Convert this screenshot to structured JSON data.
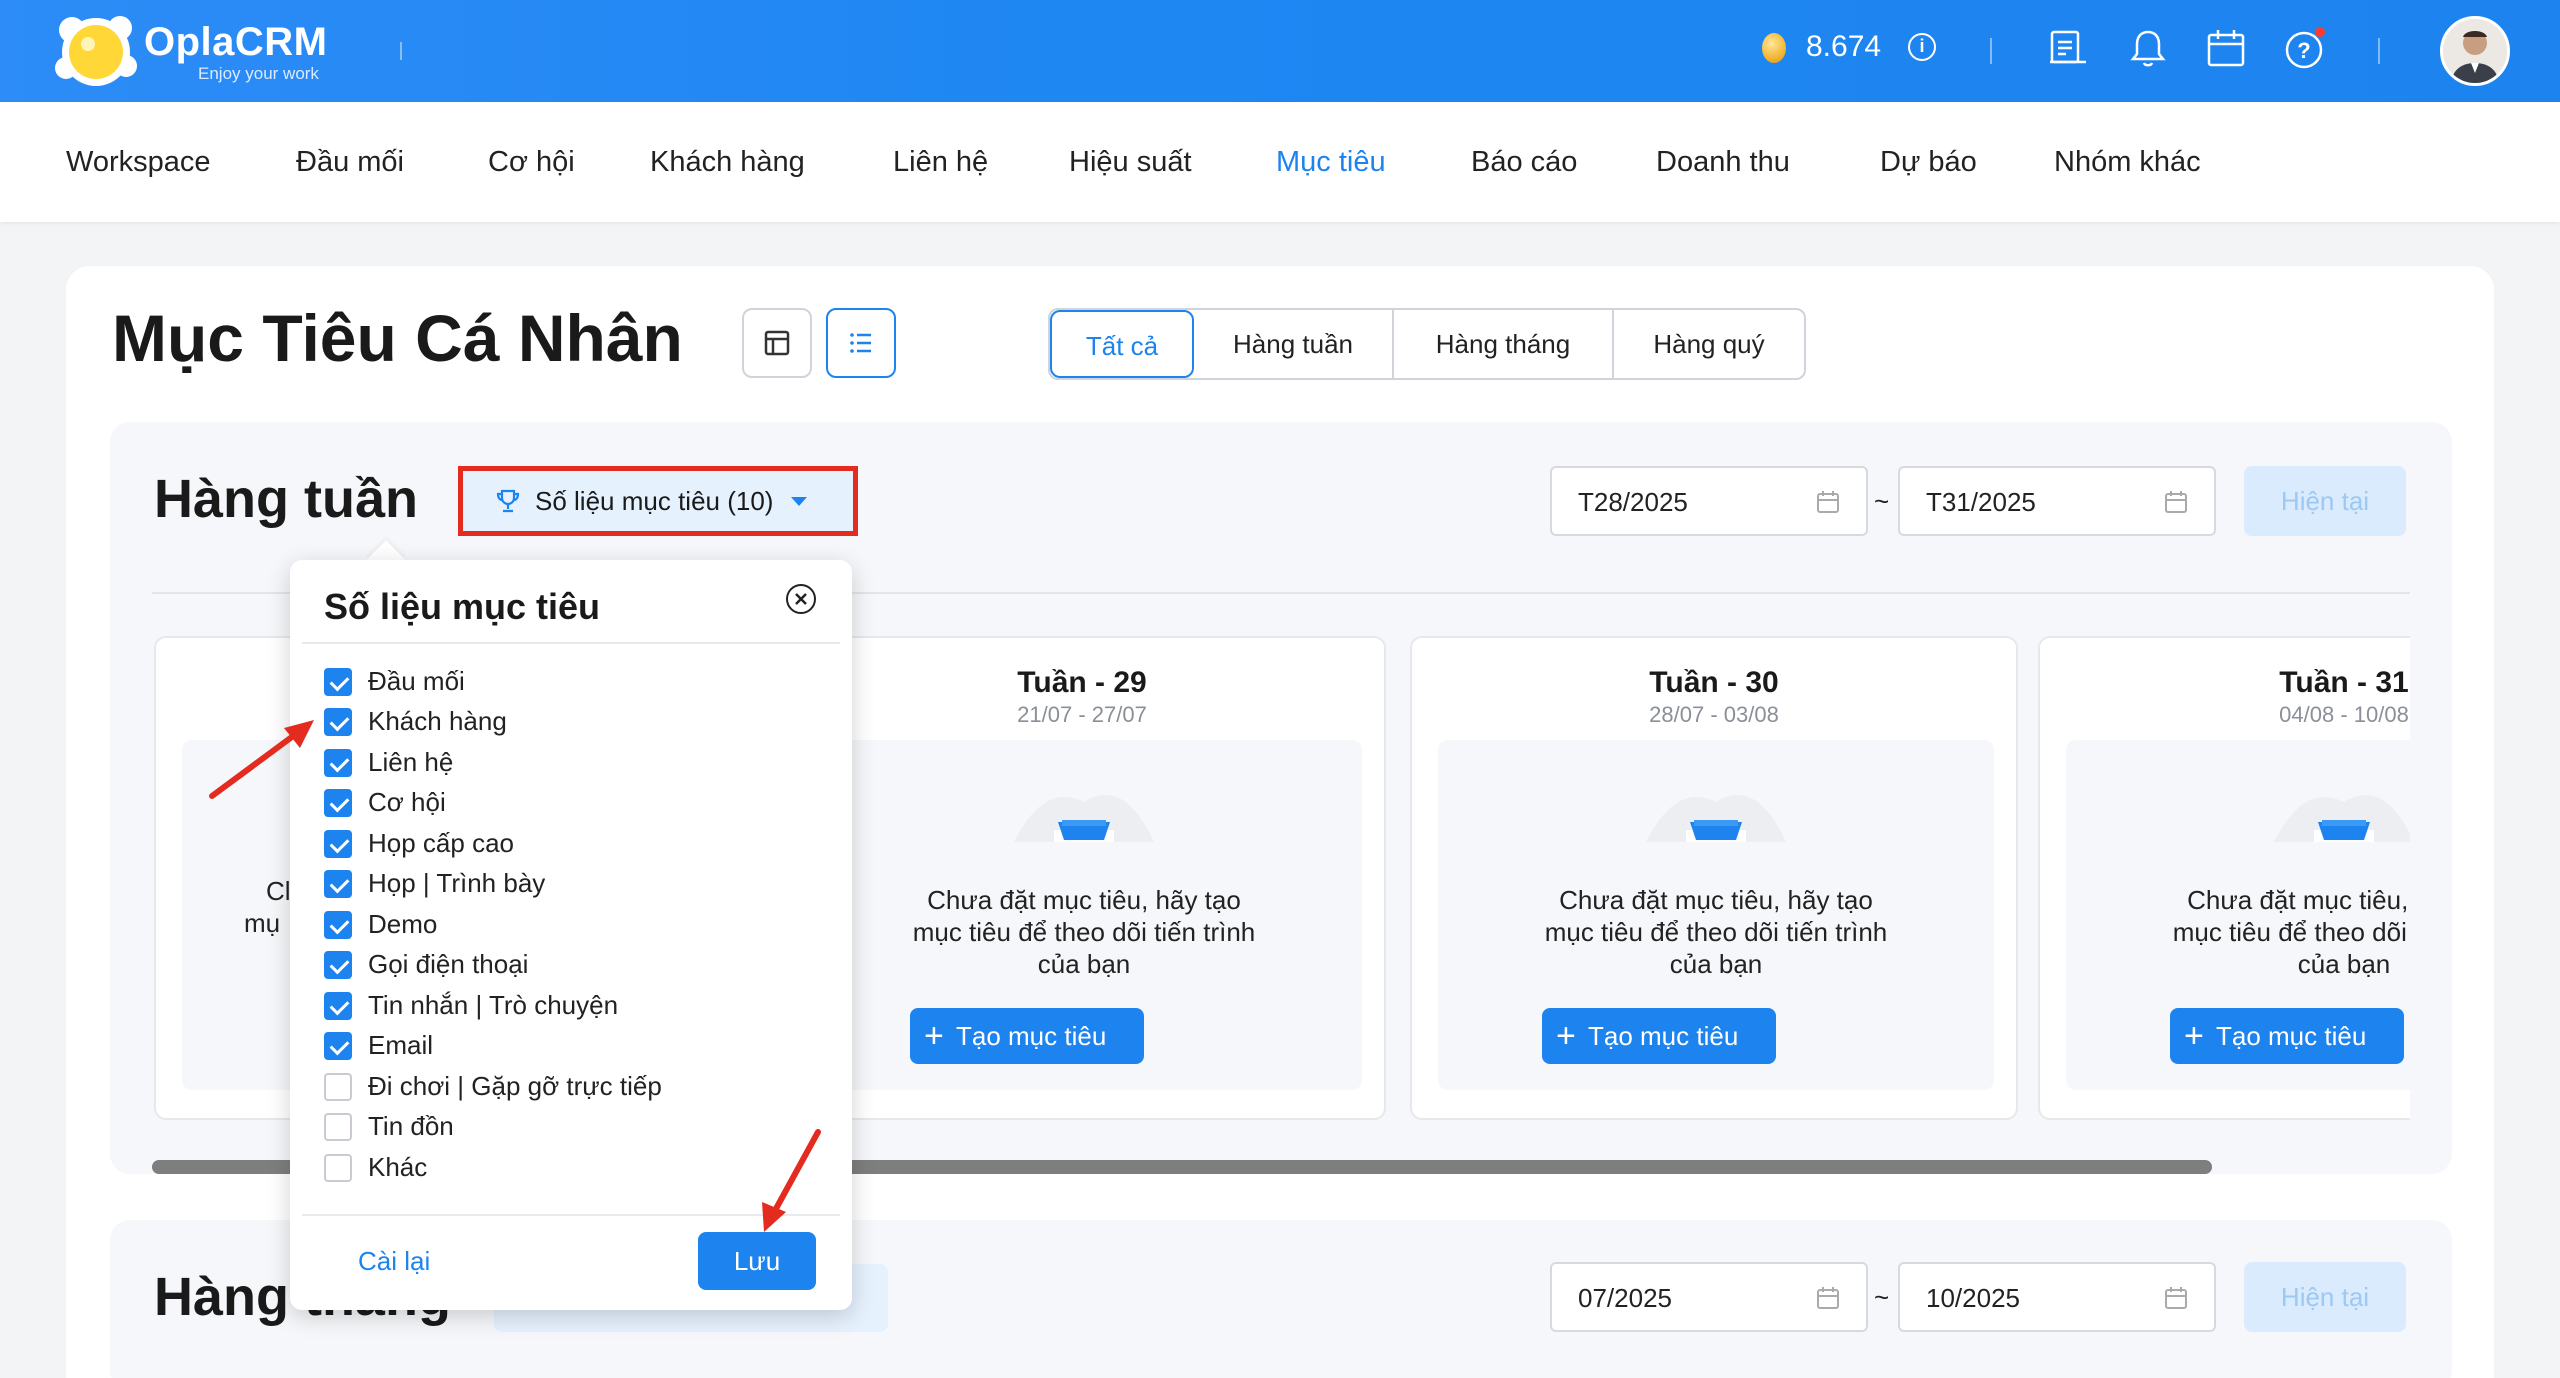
{
  "brand": {
    "name": "OplaCRM",
    "tagline": "Enjoy your work"
  },
  "header": {
    "coins": "8.674"
  },
  "nav": {
    "items": [
      "Workspace",
      "Đầu mối",
      "Cơ hội",
      "Khách hàng",
      "Liên hệ",
      "Hiệu suất",
      "Mục tiêu",
      "Báo cáo",
      "Doanh thu",
      "Dự báo",
      "Nhóm khác"
    ],
    "active": "Mục tiêu"
  },
  "page": {
    "title": "Mục Tiêu Cá Nhân"
  },
  "tabs": [
    "Tất cả",
    "Hàng tuần",
    "Hàng tháng",
    "Hàng quý"
  ],
  "weekly": {
    "title": "Hàng tuần",
    "metric_button": "Số liệu mục tiêu (10)",
    "from": "T28/2025",
    "to": "T31/2025",
    "tilde": "~",
    "now": "Hiện tại",
    "cards": [
      {
        "title": "Tuần - 29",
        "date": "21/07 - 27/07"
      },
      {
        "title": "Tuần - 30",
        "date": "28/07 - 03/08"
      },
      {
        "title": "Tuần - 31",
        "date": "04/08 - 10/08"
      }
    ],
    "empty_line1": "Chưa đặt mục tiêu, hãy tạo",
    "empty_line2": "mục tiêu để theo dõi tiến trình",
    "empty_line3": "của bạn",
    "create_label": "Tạo mục tiêu",
    "partial_card_text1": "Cl",
    "partial_card_text2": "mụ"
  },
  "monthly": {
    "title": "Hàng tháng",
    "from": "07/2025",
    "to": "10/2025",
    "tilde": "~",
    "now": "Hiện tại"
  },
  "popup": {
    "title": "Số liệu mục tiêu",
    "items": [
      {
        "label": "Đầu mối",
        "checked": true
      },
      {
        "label": "Khách hàng",
        "checked": true
      },
      {
        "label": "Liên hệ",
        "checked": true
      },
      {
        "label": "Cơ hội",
        "checked": true
      },
      {
        "label": "Họp cấp cao",
        "checked": true
      },
      {
        "label": "Họp | Trình bày",
        "checked": true
      },
      {
        "label": "Demo",
        "checked": true
      },
      {
        "label": "Gọi điện thoại",
        "checked": true
      },
      {
        "label": "Tin nhắn | Trò chuyện",
        "checked": true
      },
      {
        "label": "Email",
        "checked": true
      },
      {
        "label": "Đi chơi | Gặp gỡ trực tiếp",
        "checked": false
      },
      {
        "label": "Tin đồn",
        "checked": false
      },
      {
        "label": "Khác",
        "checked": false
      }
    ],
    "reset": "Cài lại",
    "save": "Lưu"
  },
  "colors": {
    "primary": "#1d84ef",
    "highlight": "#e32b1f"
  }
}
